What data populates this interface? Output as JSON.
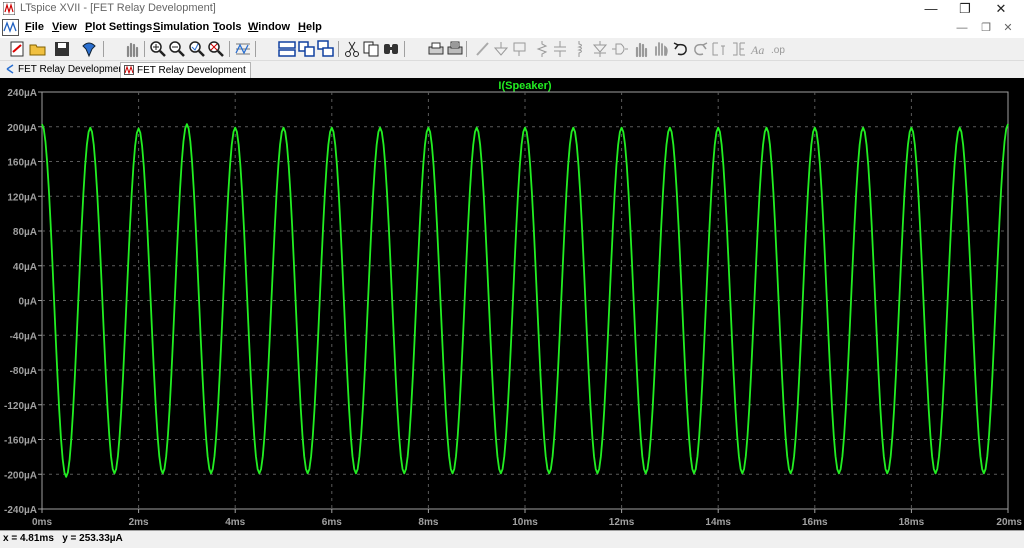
{
  "window": {
    "title": "LTspice XVII - [FET Relay Development]",
    "controls": {
      "minimize": "—",
      "restore": "❐",
      "close": "✕"
    }
  },
  "menu": {
    "items": [
      {
        "key": "F",
        "rest": "ile"
      },
      {
        "key": "V",
        "rest": "iew"
      },
      {
        "key": "P",
        "rest": "lot Settings"
      },
      {
        "key": "S",
        "rest": "imulation"
      },
      {
        "key": "T",
        "rest": "ools"
      },
      {
        "key": "W",
        "rest": "indow"
      },
      {
        "key": "H",
        "rest": "elp"
      }
    ],
    "mdi": {
      "minimize": "—",
      "restore": "❐",
      "close": "✕"
    }
  },
  "toolbar": {
    "buttons": [
      "new-schematic-icon",
      "open-folder-icon",
      "save-icon",
      "control-panel-icon",
      "pan-hand-icon",
      "zoom-in-icon",
      "zoom-out-icon",
      "zoom-fit-icon",
      "zoom-full-icon",
      "autorange-icon",
      "tile-horizontal-icon",
      "tile-vertical-icon",
      "cascade-icon",
      "cut-icon",
      "copy-icon",
      "find-icon",
      "print-icon",
      "print-setup-icon",
      "wire-icon",
      "ground-icon",
      "label-net-icon",
      "resistor-icon",
      "capacitor-icon",
      "inductor-icon",
      "diode-icon",
      "component-icon",
      "move-icon",
      "drag-icon",
      "undo-icon",
      "redo-icon",
      "rotate-icon",
      "mirror-icon",
      "text-icon",
      "spice-directive-icon"
    ]
  },
  "tabs": [
    {
      "label": "FET Relay Development",
      "icon": "schematic-icon",
      "active": false
    },
    {
      "label": "FET Relay Development",
      "icon": "waveform-icon",
      "active": true
    }
  ],
  "status": {
    "cursor": "x = 4.81ms   y = 253.33µA"
  },
  "colors": {
    "trace": "#22ee22",
    "background": "#000000",
    "axis": "#a0a0a0",
    "grid": "#5a5a5a"
  },
  "chart_data": {
    "type": "line",
    "title": "I(Speaker)",
    "xlabel": "",
    "ylabel": "",
    "x_unit": "ms",
    "y_unit": "µA",
    "xlim": [
      0,
      20
    ],
    "ylim": [
      -240,
      240
    ],
    "x_ticks": [
      "0ms",
      "2ms",
      "4ms",
      "6ms",
      "8ms",
      "10ms",
      "12ms",
      "14ms",
      "16ms",
      "18ms",
      "20ms"
    ],
    "y_ticks": [
      "240µA",
      "200µA",
      "160µA",
      "120µA",
      "80µA",
      "40µA",
      "0µA",
      "-40µA",
      "-80µA",
      "-120µA",
      "-160µA",
      "-200µA",
      "-240µA"
    ],
    "grid": true,
    "series": [
      {
        "name": "I(Speaker)",
        "shape": "sine",
        "amplitude": 200,
        "frequency_khz": 1.0,
        "phase": "cosine",
        "peaks": [
          {
            "t": 0.0,
            "value": 203
          },
          {
            "t": 1.0,
            "value": 199
          },
          {
            "t": 2.0,
            "value": 198
          },
          {
            "t": 3.0,
            "value": 203
          },
          {
            "t": 4.0,
            "value": 199
          },
          {
            "t": 5.0,
            "value": 199
          },
          {
            "t": 6.0,
            "value": 199
          },
          {
            "t": 7.0,
            "value": 199
          },
          {
            "t": 8.0,
            "value": 199
          },
          {
            "t": 9.0,
            "value": 199
          },
          {
            "t": 10.0,
            "value": 199
          },
          {
            "t": 11.0,
            "value": 199
          },
          {
            "t": 12.0,
            "value": 199
          },
          {
            "t": 13.0,
            "value": 199
          },
          {
            "t": 14.0,
            "value": 199
          },
          {
            "t": 15.0,
            "value": 199
          },
          {
            "t": 16.0,
            "value": 199
          },
          {
            "t": 17.0,
            "value": 199
          },
          {
            "t": 18.0,
            "value": 199
          },
          {
            "t": 19.0,
            "value": 199
          },
          {
            "t": 20.0,
            "value": 203
          }
        ],
        "troughs": [
          {
            "t": 0.5,
            "value": -203
          },
          {
            "t": 1.5,
            "value": -199
          },
          {
            "t": 2.5,
            "value": -199
          },
          {
            "t": 3.5,
            "value": -199
          },
          {
            "t": 4.5,
            "value": -199
          },
          {
            "t": 5.5,
            "value": -199
          },
          {
            "t": 6.5,
            "value": -199
          },
          {
            "t": 7.5,
            "value": -199
          },
          {
            "t": 8.5,
            "value": -199
          },
          {
            "t": 9.5,
            "value": -199
          },
          {
            "t": 10.5,
            "value": -199
          },
          {
            "t": 11.5,
            "value": -199
          },
          {
            "t": 12.5,
            "value": -199
          },
          {
            "t": 13.5,
            "value": -199
          },
          {
            "t": 14.5,
            "value": -199
          },
          {
            "t": 15.5,
            "value": -199
          },
          {
            "t": 16.5,
            "value": -199
          },
          {
            "t": 17.5,
            "value": -199
          },
          {
            "t": 18.5,
            "value": -199
          },
          {
            "t": 19.5,
            "value": -199
          }
        ]
      }
    ]
  }
}
